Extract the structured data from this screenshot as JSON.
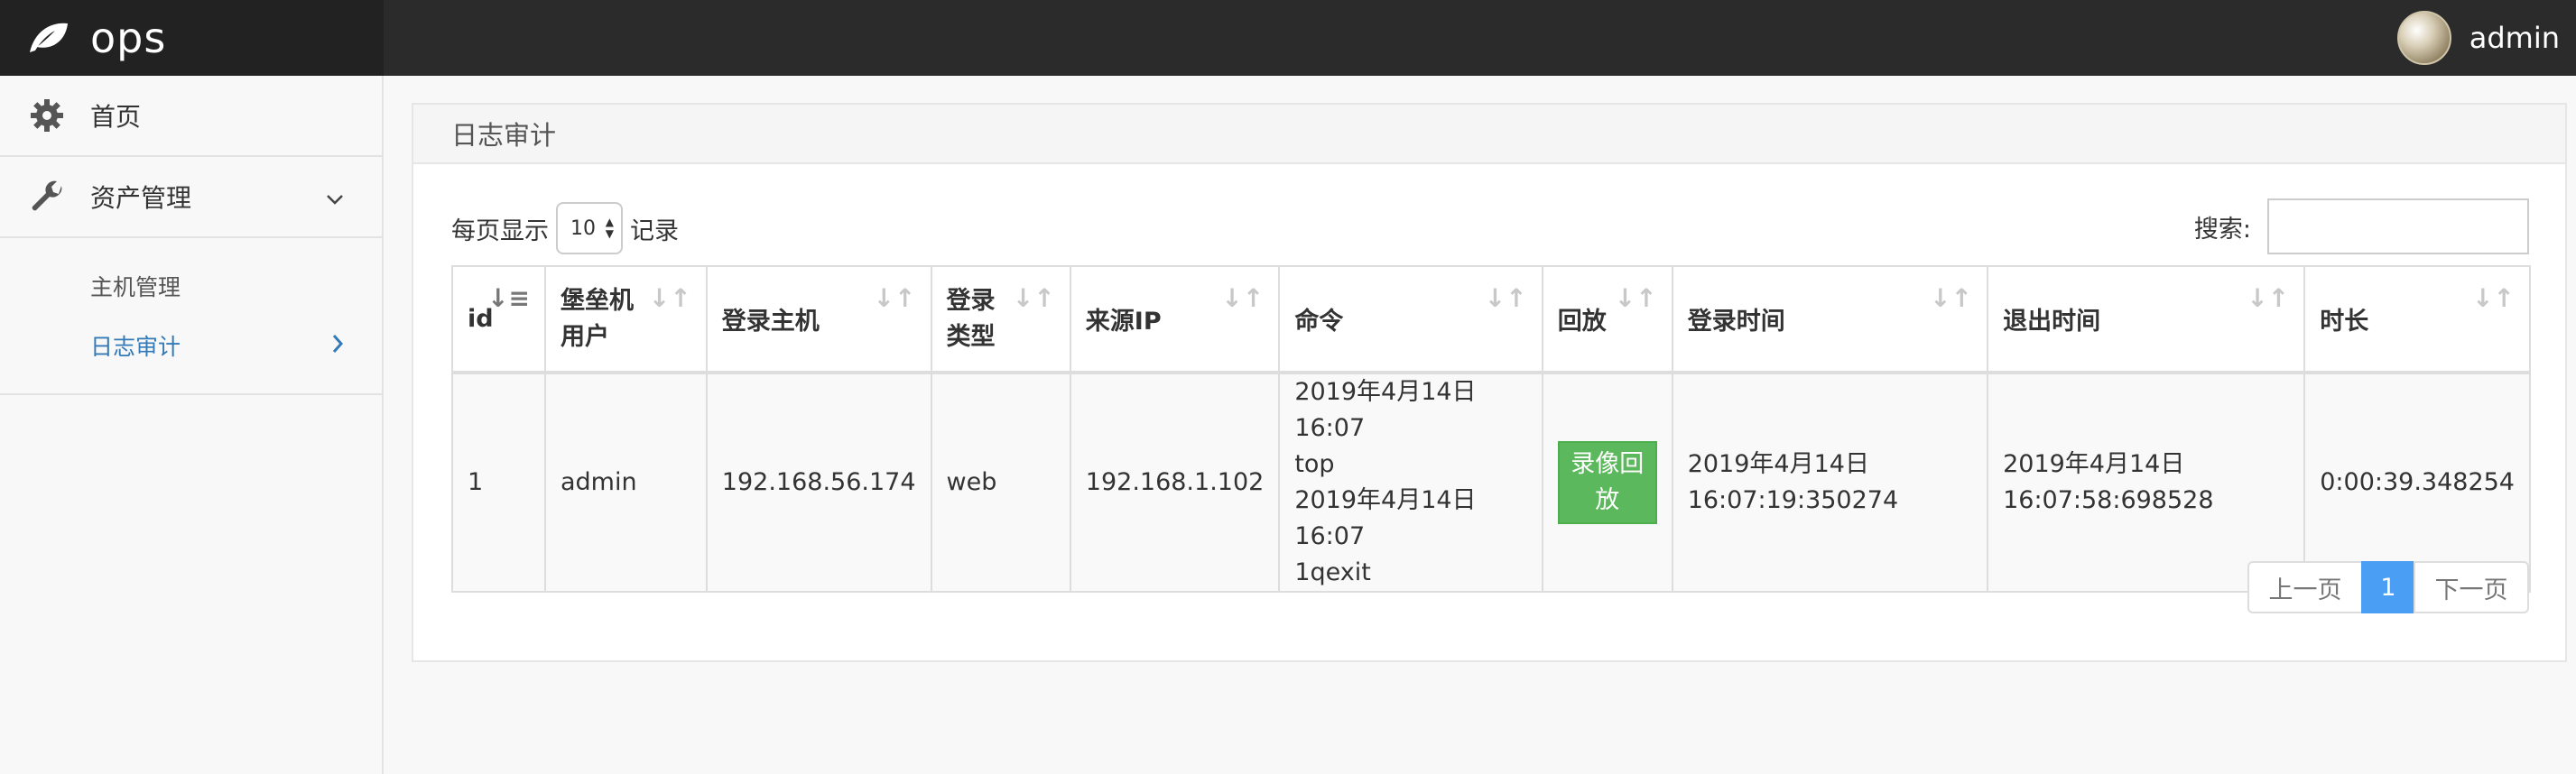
{
  "app": {
    "title": "ops",
    "user": "admin"
  },
  "sidebar": {
    "items": [
      {
        "label": "首页",
        "icon": "gear-icon"
      },
      {
        "label": "资产管理",
        "icon": "wrench-icon"
      }
    ],
    "sub_items": [
      {
        "label": "主机管理"
      },
      {
        "label": "日志审计"
      }
    ]
  },
  "panel": {
    "title": "日志审计",
    "length_prefix": "每页显示",
    "length_value": "10",
    "length_suffix": "记录",
    "search_label": "搜索:",
    "search_value": ""
  },
  "table": {
    "headers": [
      "id",
      "堡垒机用户",
      "登录主机",
      "登录类型",
      "来源IP",
      "命令",
      "回放",
      "登录时间",
      "退出时间",
      "时长"
    ],
    "rows": [
      {
        "id": "1",
        "user": "admin",
        "host": "192.168.56.174",
        "type": "web",
        "ip": "192.168.1.102",
        "cmd": [
          "2019年4月14日 16:07",
          "top",
          "2019年4月14日 16:07",
          "1qexit"
        ],
        "replay": "录像回放",
        "login_time": [
          "2019年4月14日",
          "16:07:19:350274"
        ],
        "logout_time": [
          "2019年4月14日",
          "16:07:58:698528"
        ],
        "duration": "0:00:39.348254"
      }
    ]
  },
  "pager": {
    "prev": "上一页",
    "current": "1",
    "next": "下一页"
  },
  "colors": {
    "accent": "#337ab7",
    "success": "#5cb85c",
    "page_active": "#4a9ff5",
    "navbar": "#2b2b2b"
  }
}
